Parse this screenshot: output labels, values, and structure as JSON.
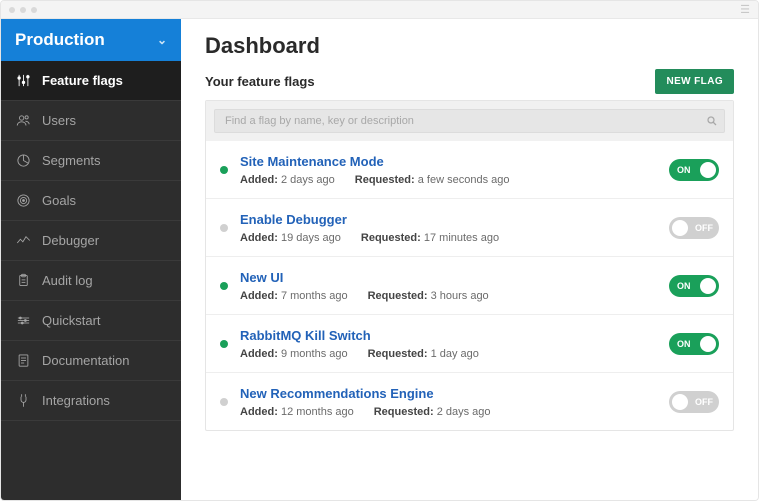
{
  "env_selector": {
    "label": "Production"
  },
  "sidebar": {
    "items": [
      {
        "label": "Feature flags",
        "active": true,
        "icon": "sliders"
      },
      {
        "label": "Users",
        "active": false,
        "icon": "users"
      },
      {
        "label": "Segments",
        "active": false,
        "icon": "pie"
      },
      {
        "label": "Goals",
        "active": false,
        "icon": "target"
      },
      {
        "label": "Debugger",
        "active": false,
        "icon": "spark"
      },
      {
        "label": "Audit log",
        "active": false,
        "icon": "clipboard"
      },
      {
        "label": "Quickstart",
        "active": false,
        "icon": "route"
      },
      {
        "label": "Documentation",
        "active": false,
        "icon": "doc"
      },
      {
        "label": "Integrations",
        "active": false,
        "icon": "plug"
      }
    ]
  },
  "page": {
    "title": "Dashboard"
  },
  "sub": {
    "heading": "Your feature flags"
  },
  "buttons": {
    "new_flag": "NEW FLAG"
  },
  "search": {
    "placeholder": "Find a flag by name, key or description"
  },
  "labels": {
    "added": "Added:",
    "requested": "Requested:",
    "on": "ON",
    "off": "OFF"
  },
  "flags": [
    {
      "name": "Site Maintenance Mode",
      "added": "2 days ago",
      "requested": "a few seconds ago",
      "on": true
    },
    {
      "name": "Enable Debugger",
      "added": "19 days ago",
      "requested": "17 minutes ago",
      "on": false
    },
    {
      "name": "New UI",
      "added": "7 months ago",
      "requested": "3 hours ago",
      "on": true
    },
    {
      "name": "RabbitMQ Kill Switch",
      "added": "9 months ago",
      "requested": "1 day ago",
      "on": true
    },
    {
      "name": "New Recommendations Engine",
      "added": "12 months ago",
      "requested": "2 days ago",
      "on": false
    }
  ]
}
